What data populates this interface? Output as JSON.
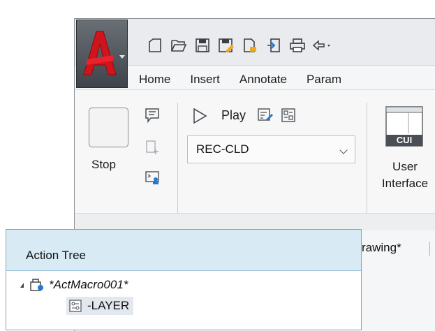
{
  "ribbon": {
    "tabs": [
      "Home",
      "Insert",
      "Annotate",
      "Param"
    ],
    "stop_label": "Stop",
    "play_label": "Play",
    "macro_select_value": "REC-CLD",
    "cui_icon_text": "CUI",
    "user_interface_line1": "User",
    "user_interface_line2": "Interface"
  },
  "qat_icons": [
    "new-icon",
    "open-icon",
    "save-icon",
    "save-as-icon",
    "publish-icon",
    "import-icon",
    "plot-icon",
    "undo-icon"
  ],
  "action_tree": {
    "title": "Action Tree",
    "root_label": "*ActMacro001*",
    "child_label": "-LAYER"
  },
  "drawing_tab_label": "rawing*",
  "colors": {
    "autocad_red": "#c8171f",
    "panel_header_bg": "#d8eaf4"
  }
}
